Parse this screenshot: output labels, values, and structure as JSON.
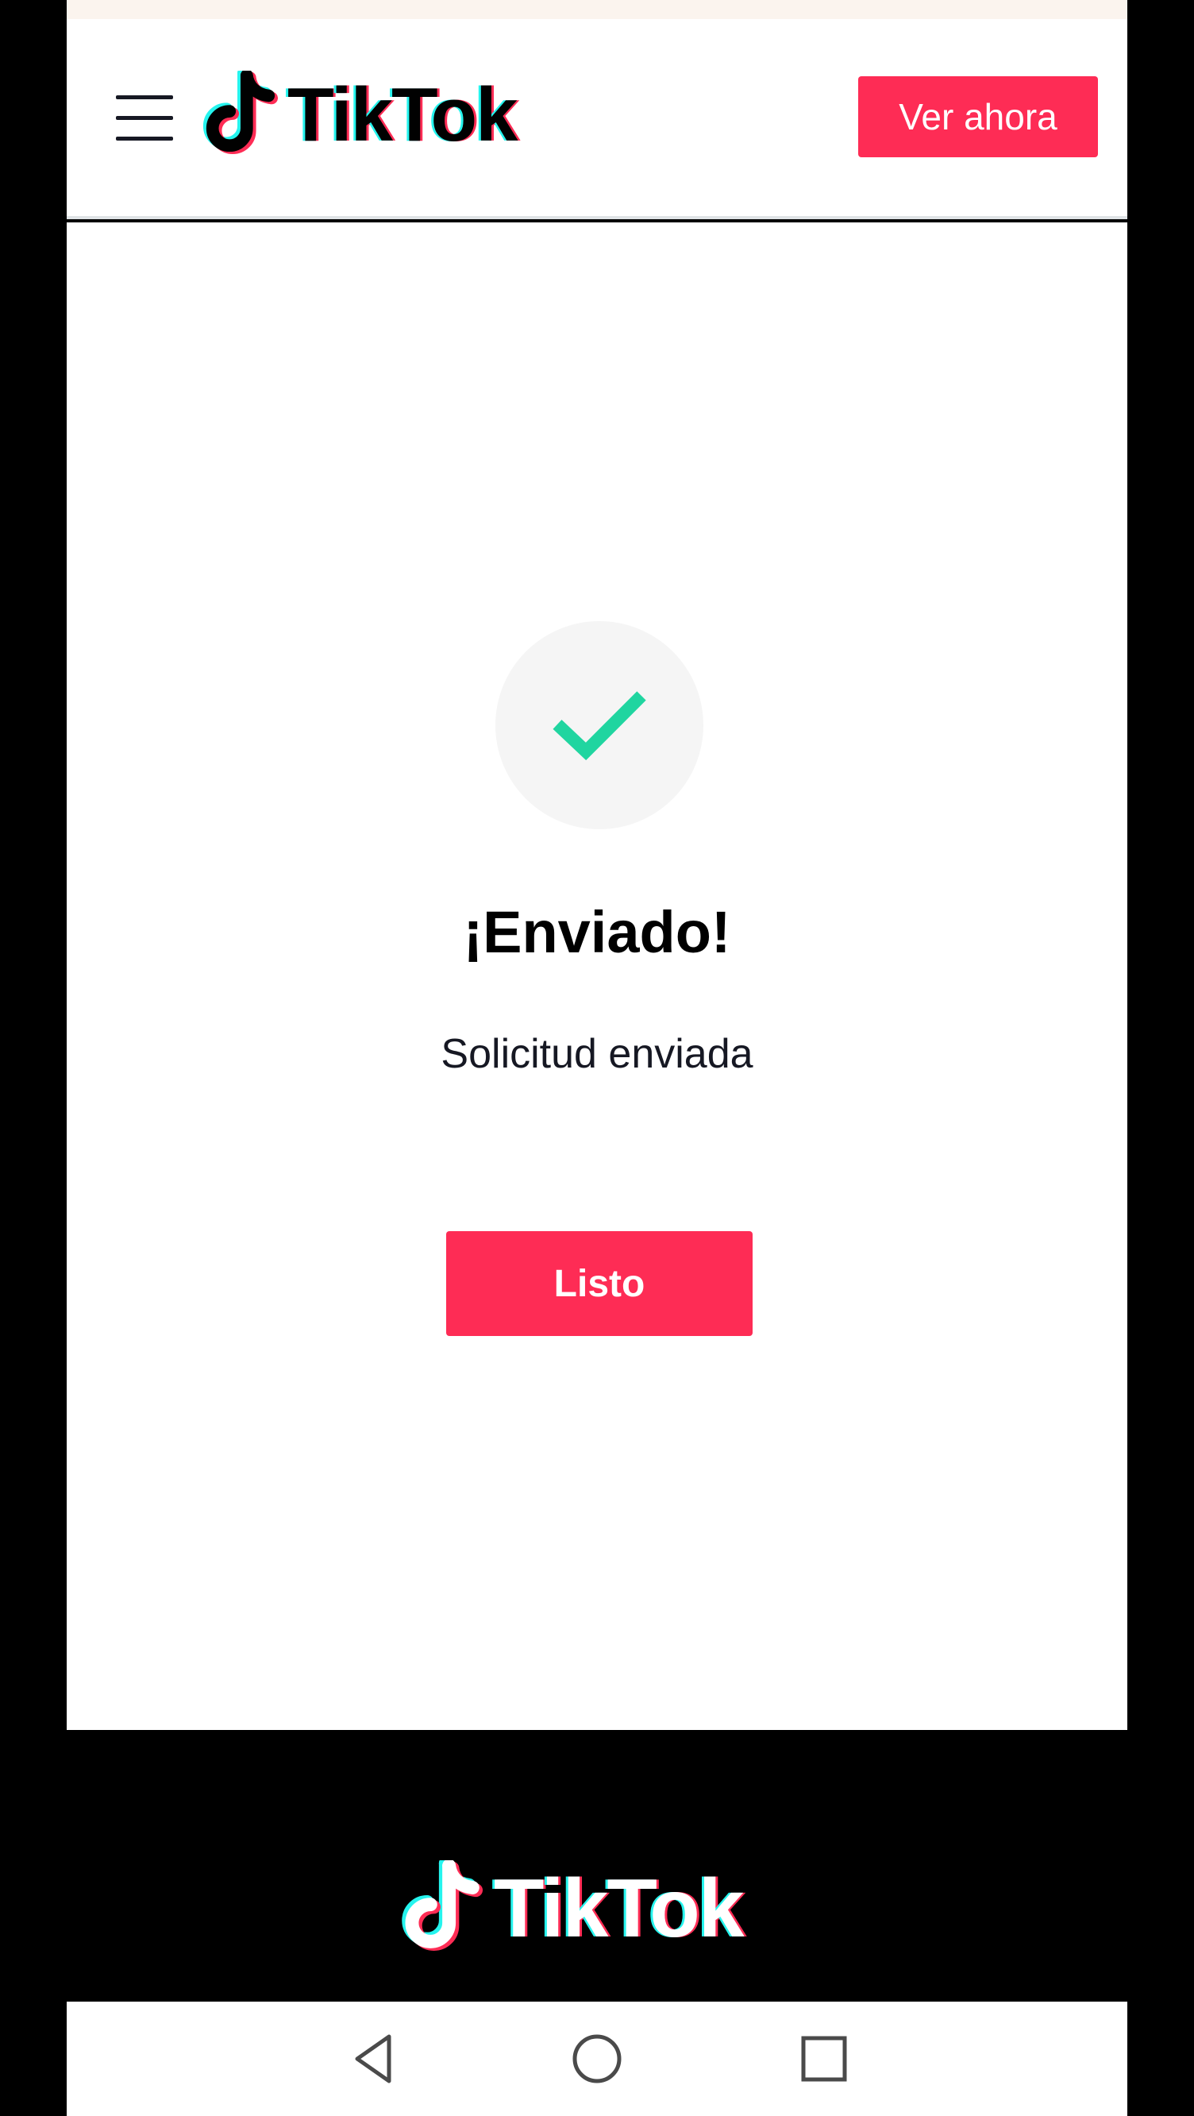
{
  "header": {
    "logo_text": "TikTok",
    "cta_label": "Ver ahora"
  },
  "main": {
    "title": "¡Enviado!",
    "subtitle": "Solicitud enviada",
    "done_label": "Listo"
  },
  "footer": {
    "logo_text": "TikTok"
  },
  "icons": {
    "menu": "hamburger-menu-icon",
    "logo": "tiktok-note-icon",
    "success": "checkmark-icon",
    "back": "back-triangle-icon",
    "home": "home-circle-icon",
    "recents": "recents-square-icon"
  },
  "colors": {
    "brand": "#fe2c55",
    "check": "#20d5a0",
    "cyan": "#25f4ee"
  }
}
